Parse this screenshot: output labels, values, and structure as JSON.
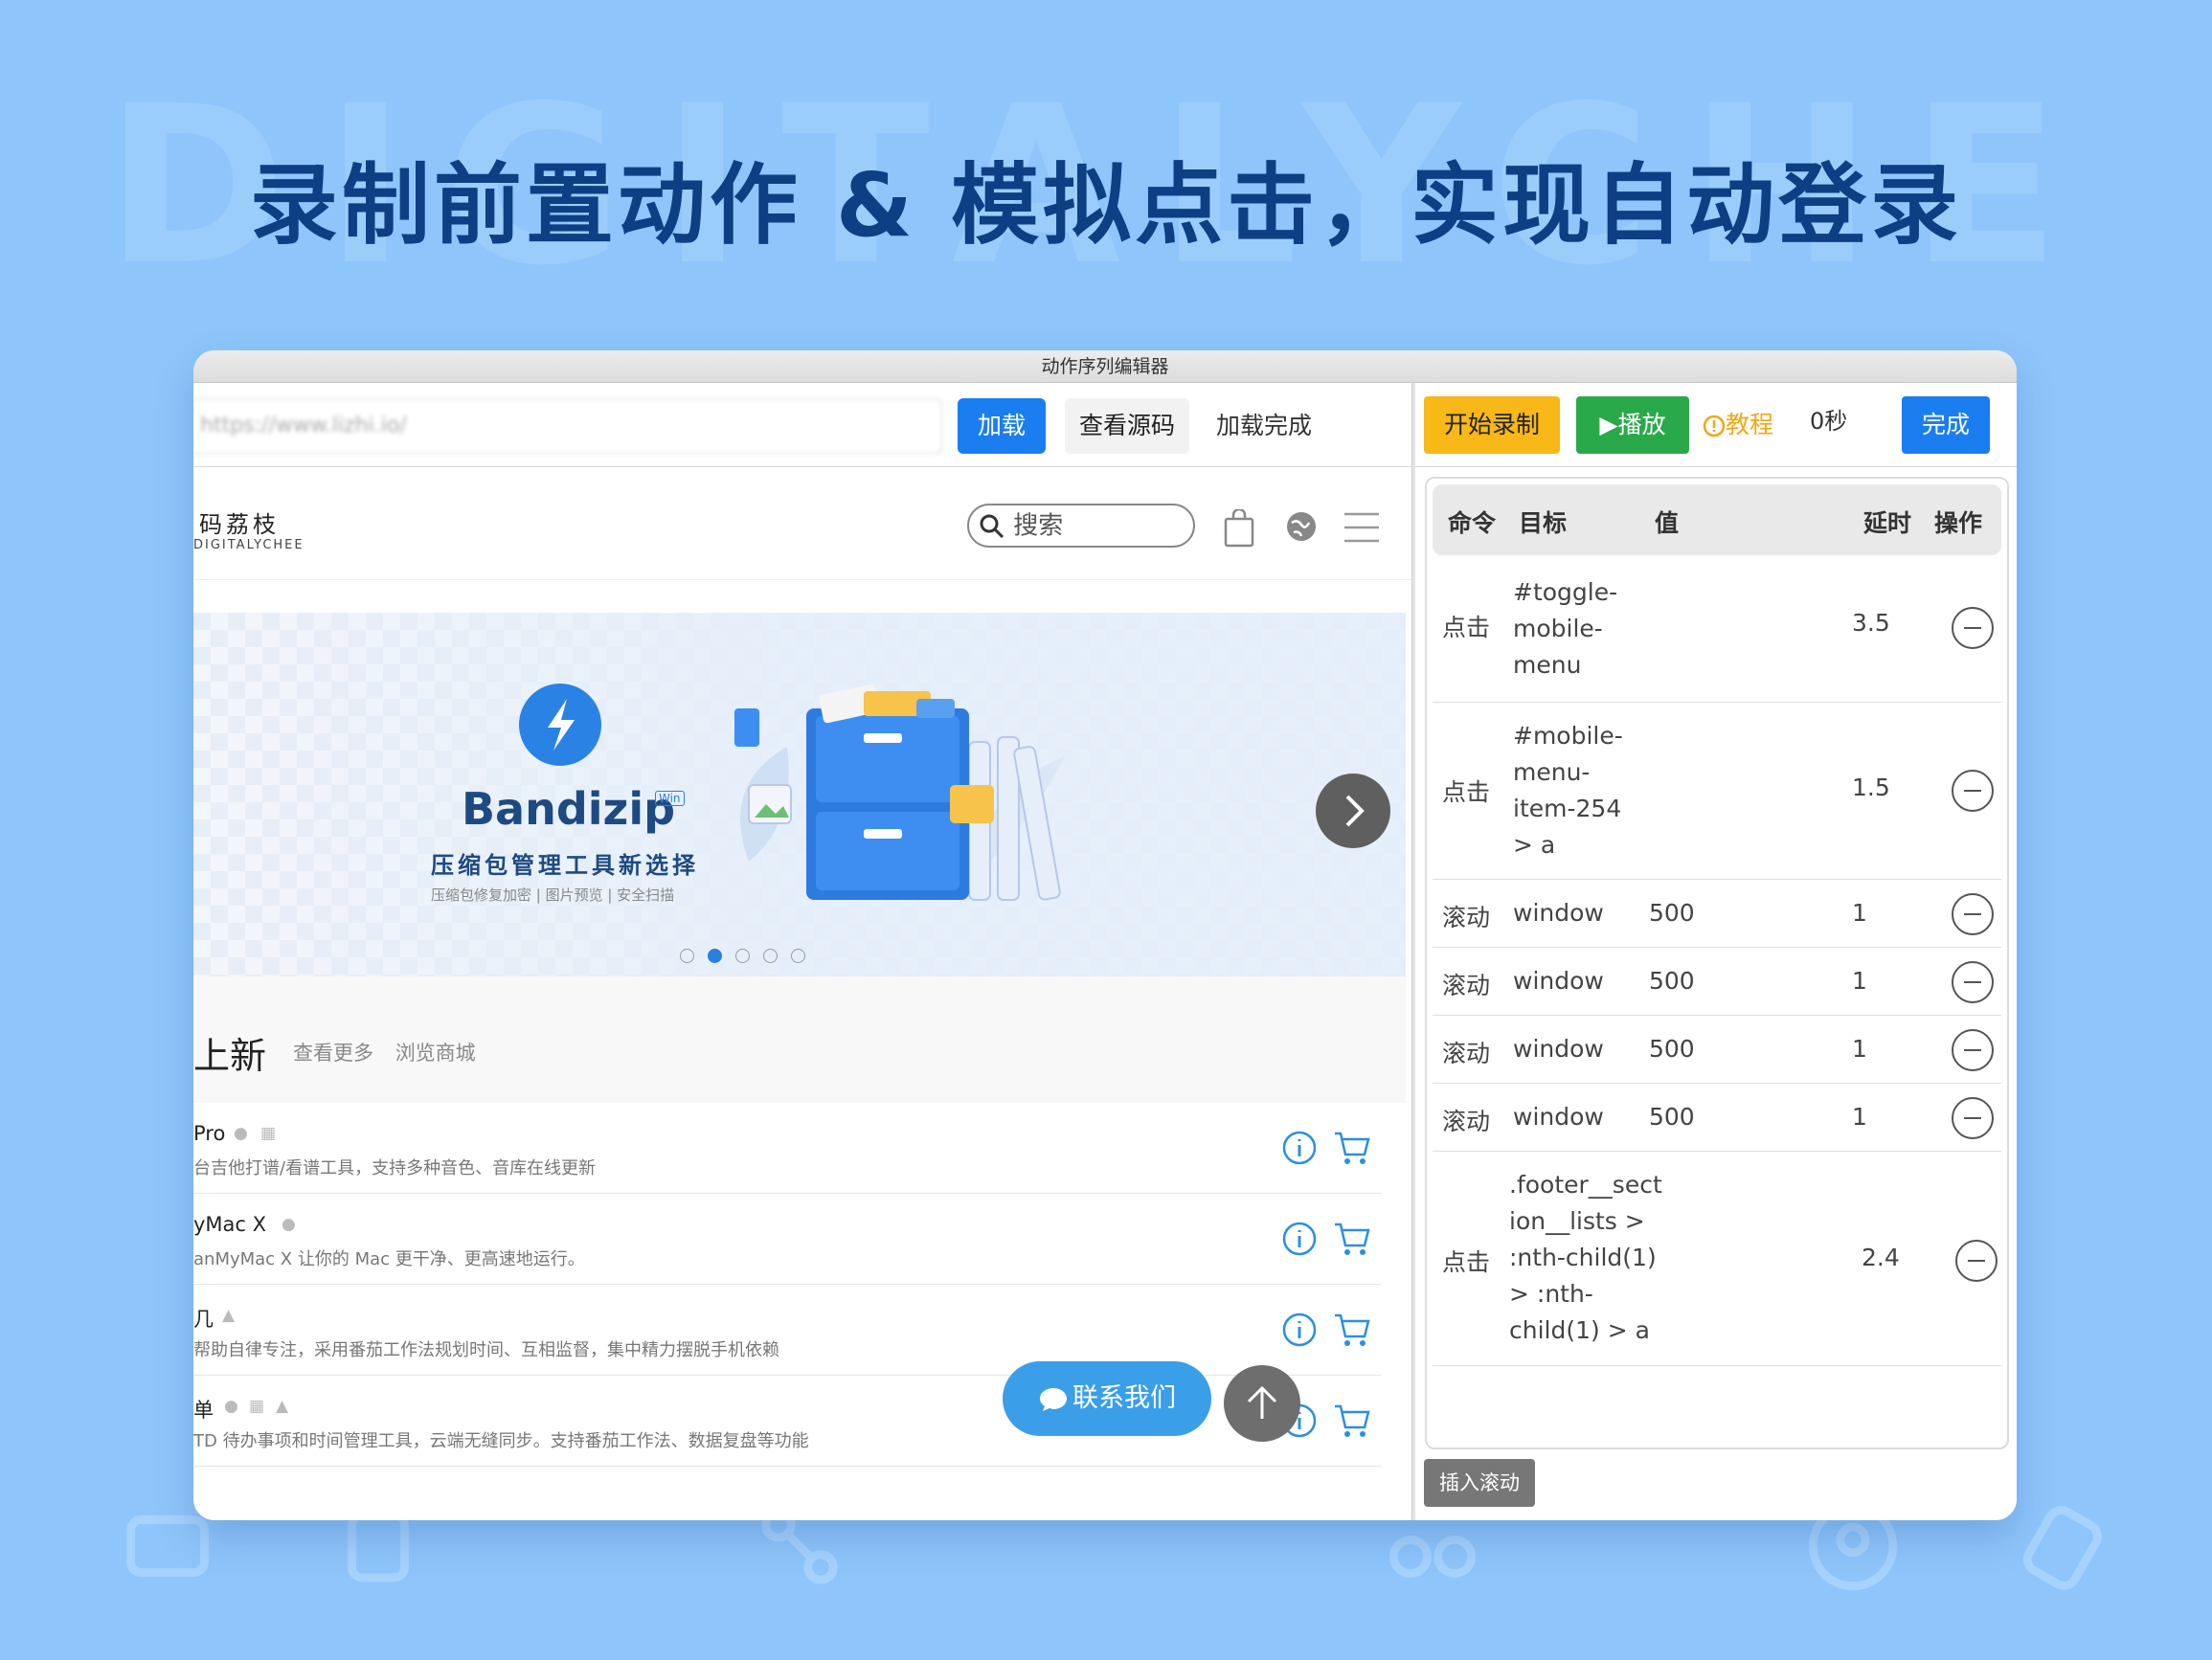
{
  "poster": {
    "watermark": "DIGITALYCHEE",
    "headline": "录制前置动作 & 模拟点击，实现自动登录"
  },
  "window": {
    "title": "动作序列编辑器"
  },
  "browser": {
    "url_value": "https://www.lizhi.io/",
    "load_label": "加载",
    "view_source_label": "查看源码",
    "status": "加载完成"
  },
  "site": {
    "logo_cn": "码荔枝",
    "logo_en": "DIGITALYCHEE",
    "search_placeholder": "搜索",
    "banner": {
      "product": "Bandizip",
      "badge": "Win",
      "subtitle": "压缩包管理工具新选择",
      "tags": "压缩包修复加密 | 图片预览 | 安全扫描",
      "active_slide": 2,
      "slide_count": 5
    },
    "section": {
      "title": "上新",
      "links": [
        "查看更多",
        "浏览商城"
      ]
    },
    "products": [
      {
        "name": "Pro",
        "platforms": [
          "apple-icon",
          "windows-icon"
        ],
        "desc": "台吉他打谱/看谱工具，支持多种音色、音库在线更新"
      },
      {
        "name": "yMac X",
        "platforms": [
          "apple-icon"
        ],
        "desc": "anMyMac X 让你的 Mac 更干净、更高速地运行。"
      },
      {
        "name": "几",
        "platforms": [
          "android-icon"
        ],
        "desc": "帮助自律专注，采用番茄工作法规划时间、互相监督，集中精力摆脱手机依赖"
      },
      {
        "name": "单",
        "platforms": [
          "apple-icon",
          "windows-icon",
          "android-icon"
        ],
        "desc": "TD 待办事项和时间管理工具，云端无缝同步。支持番茄工作法、数据复盘等功能"
      }
    ],
    "contact_label": "联系我们"
  },
  "editor": {
    "record_label": "开始录制",
    "play_label": "播放",
    "tutorial_label": "教程",
    "timer": "0秒",
    "done_label": "完成",
    "columns": [
      "命令",
      "目标",
      "值",
      "延时",
      "操作"
    ],
    "rows": [
      {
        "cmd": "点击",
        "target": [
          "#toggle-",
          "mobile-",
          "menu"
        ],
        "value": "",
        "delay": "3.5"
      },
      {
        "cmd": "点击",
        "target": [
          "#mobile-",
          "menu-",
          "item-254",
          "> a"
        ],
        "value": "",
        "delay": "1.5"
      },
      {
        "cmd": "滚动",
        "target": [
          "window"
        ],
        "value": "500",
        "delay": "1"
      },
      {
        "cmd": "滚动",
        "target": [
          "window"
        ],
        "value": "500",
        "delay": "1"
      },
      {
        "cmd": "滚动",
        "target": [
          "window"
        ],
        "value": "500",
        "delay": "1"
      },
      {
        "cmd": "滚动",
        "target": [
          "window"
        ],
        "value": "500",
        "delay": "1"
      },
      {
        "cmd": "点击",
        "target": [
          ".footer__sect",
          "ion__lists >",
          ":nth-child(1)",
          "> :nth-",
          "child(1) > a"
        ],
        "value": "",
        "delay": "2.4"
      }
    ],
    "insert_scroll_label": "插入滚动"
  },
  "colors": {
    "background": "#8ec6fb",
    "headline": "#0d3f84",
    "primary": "#1a7ef0",
    "record": "#f8b818",
    "play": "#2aa94a",
    "tutorial": "#f3a712"
  }
}
